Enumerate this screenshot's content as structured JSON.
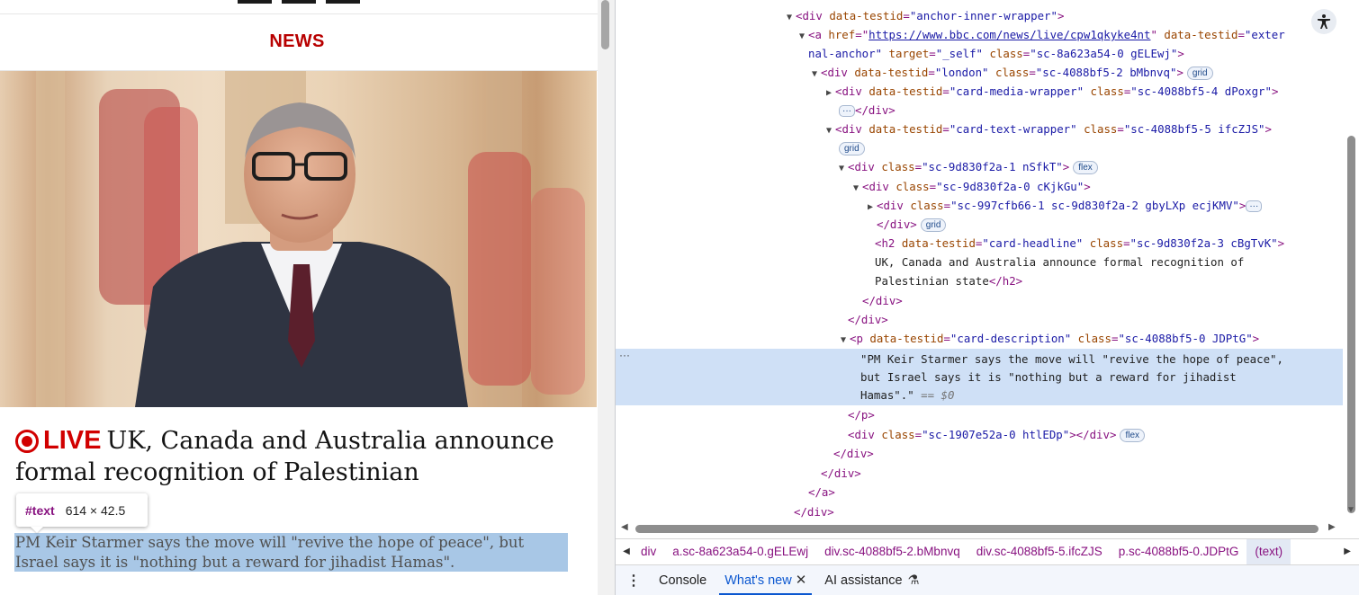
{
  "page": {
    "section_label": "NEWS",
    "live_label": "LIVE",
    "headline": "UK, Canada and Australia announce formal recognition of Palestinian",
    "description": "PM Keir Starmer says the move will \"revive the hope of peace\", but Israel says it is \"nothing but a reward for jihadist Hamas\".",
    "tooltip": {
      "node": "#text",
      "dimensions": "614 × 42.5"
    },
    "image": "Keir Starmer speaking at a lectern",
    "colors": {
      "brand": "#b80000",
      "live": "#d10000",
      "highlight": "#a8c7e6"
    }
  },
  "devtools": {
    "dom": {
      "l0": {
        "tag_open": "<div ",
        "attr": "data-testid",
        "val": "\"anchor-inner-wrapper\"",
        "tag_close": ">"
      },
      "l1": {
        "tag_open": "<a ",
        "a1": "href",
        "v1": "https://www.bbc.com/news/live/cpw1qkyke4nt",
        "a2": "data-testid",
        "v2": "\"exter",
        "wrap": "nal-anchor\"",
        "a3": "target",
        "v3": "\"_self\"",
        "a4": "class",
        "v4": "\"sc-8a623a54-0 gELEwj\"",
        "tag_close": ">"
      },
      "l2": {
        "tag_open": "<div ",
        "a1": "data-testid",
        "v1": "\"london\"",
        "a2": "class",
        "v2": "\"sc-4088bf5-2 bMbnvq\"",
        "tag_close": ">",
        "badge": "grid"
      },
      "l3": {
        "tag_open": "<div ",
        "a1": "data-testid",
        "v1": "\"card-media-wrapper\"",
        "a2": "class",
        "v2": "\"sc-4088bf5-4 dPoxgr\"",
        "tag_close": ">",
        "close": "</div>",
        "ellipsis": "···"
      },
      "l4": {
        "tag_open": "<div ",
        "a1": "data-testid",
        "v1": "\"card-text-wrapper\"",
        "a2": "class",
        "v2": "\"sc-4088bf5-5 ifcZJS\"",
        "tag_close": ">",
        "badge": "grid"
      },
      "l5": {
        "tag_open": "<div ",
        "a1": "class",
        "v1": "\"sc-9d830f2a-1 nSfkT\"",
        "tag_close": ">",
        "badge": "flex"
      },
      "l6": {
        "tag_open": "<div ",
        "a1": "class",
        "v1": "\"sc-9d830f2a-0 cKjkGu\"",
        "tag_close": ">"
      },
      "l7": {
        "tag_open": "<div ",
        "a1": "class",
        "v1": "\"sc-997cfb66-1 sc-9d830f2a-2 gbyLXp ecjKMV\"",
        "tag_close": ">",
        "ellipsis": "···",
        "close": "</div>",
        "badge": "grid"
      },
      "l8": {
        "tag_open": "<h2 ",
        "a1": "data-testid",
        "v1": "\"card-headline\"",
        "a2": "class",
        "v2": "\"sc-9d830f2a-3 cBgTvK\"",
        "tag_close": ">",
        "text1": "UK, Canada and Australia announce formal recognition of",
        "text2": "Palestinian state",
        "close": "</h2>"
      },
      "close_div": "</div>",
      "l9": {
        "tag_open": "<p ",
        "a1": "data-testid",
        "v1": "\"card-description\"",
        "a2": "class",
        "v2": "\"sc-4088bf5-0 JDPtG\"",
        "tag_close": ">"
      },
      "selected_text": {
        "t1": "\"PM Keir Starmer says the move will \"revive the hope of peace\",",
        "t2": "but Israel says it is \"nothing but a reward for jihadist",
        "t3": "Hamas\".\"",
        "eq": " == $0"
      },
      "close_p": "</p>",
      "l10": {
        "tag_open": "<div ",
        "a1": "class",
        "v1": "\"sc-1907e52a-0 htlEDp\"",
        "tag_close": "></div>",
        "badge": "flex"
      },
      "close_a": "</a>",
      "gutter": "···"
    },
    "breadcrumbs": [
      "div",
      "a.sc-8a623a54-0.gELEwj",
      "div.sc-4088bf5-2.bMbnvq",
      "div.sc-4088bf5-5.ifcZJS",
      "p.sc-4088bf5-0.JDPtG",
      "(text)"
    ],
    "drawer_tabs": {
      "console": "Console",
      "whats_new": "What's new",
      "ai": "AI assistance"
    }
  }
}
